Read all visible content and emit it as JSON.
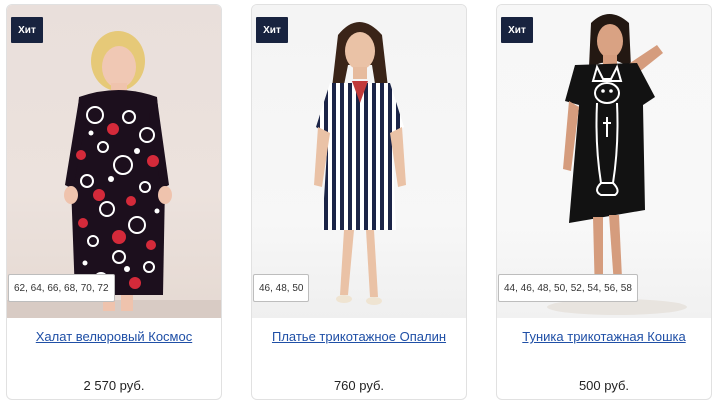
{
  "products": [
    {
      "badge": "Хит",
      "sizes": "62, 64, 66, 68, 70, 72",
      "name": "Халат велюровый Космос",
      "price": "2 570 руб.",
      "image": "woman-in-black-robe-with-red-white-circles"
    },
    {
      "badge": "Хит",
      "sizes": "46, 48, 50",
      "name": "Платье трикотажное Опалин",
      "price": "760 руб.",
      "image": "woman-in-navy-white-striped-dress"
    },
    {
      "badge": "Хит",
      "sizes": "44, 46, 48, 50, 52, 54, 56, 58",
      "name": "Туника трикотажная Кошка",
      "price": "500 руб.",
      "image": "woman-in-black-tunic-with-cat-print"
    }
  ],
  "colors": {
    "badge_bg": "#18233f",
    "link": "#1f4fa6",
    "card_border": "#e1e1e1"
  }
}
